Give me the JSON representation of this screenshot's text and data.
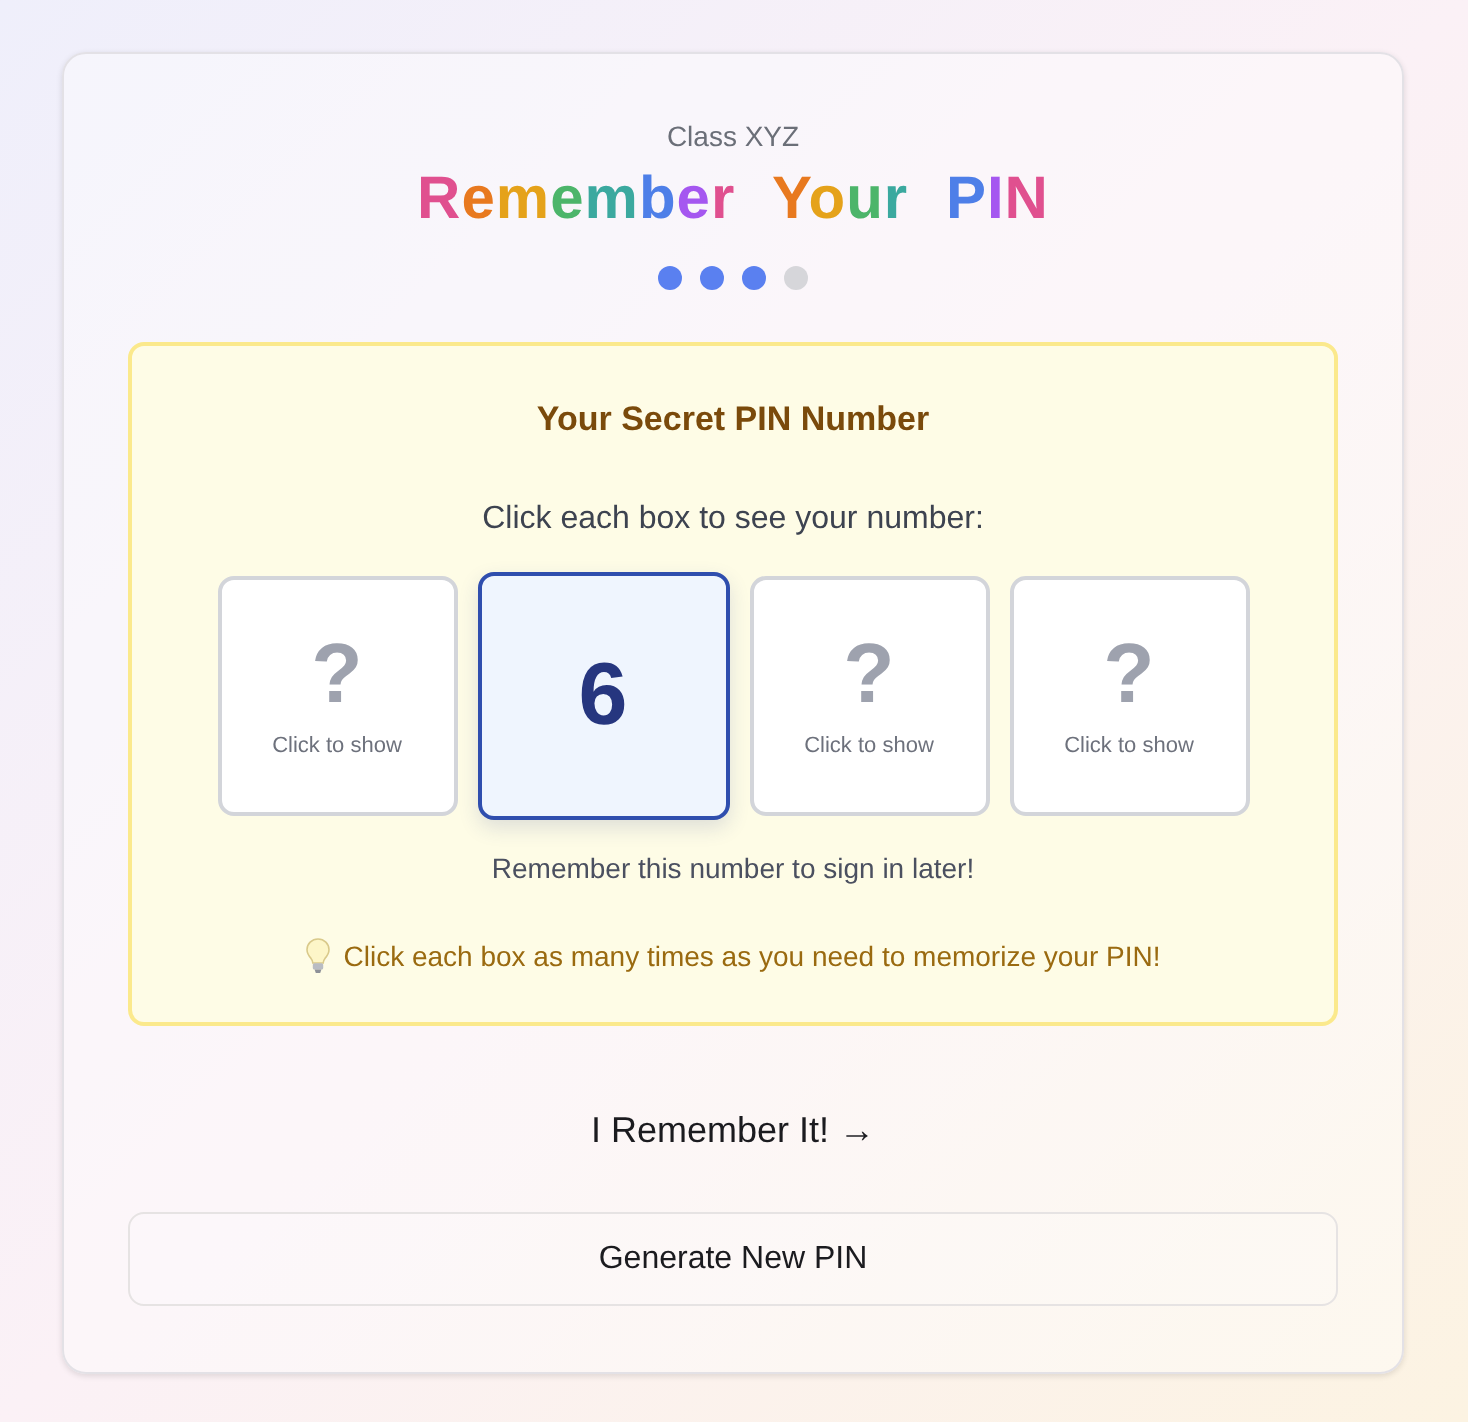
{
  "header": {
    "subtitle": "Class XYZ",
    "title": "Remember Your PIN"
  },
  "progress_steps": [
    {
      "completed": true
    },
    {
      "completed": true
    },
    {
      "completed": true
    },
    {
      "completed": false
    }
  ],
  "pin_panel": {
    "heading": "Your Secret PIN Number",
    "instruction": "Click each box to see your number:",
    "digits": [
      {
        "revealed": false,
        "symbol": "?",
        "caption": "Click to show"
      },
      {
        "revealed": true,
        "symbol": "6"
      },
      {
        "revealed": false,
        "symbol": "?",
        "caption": "Click to show"
      },
      {
        "revealed": false,
        "symbol": "?",
        "caption": "Click to show"
      }
    ],
    "reminder": "Remember this number to sign in later!",
    "tip": "Click each box as many times as you need to memorize your PIN!"
  },
  "actions": {
    "confirm": "I Remember It! →",
    "regenerate": "Generate New PIN"
  }
}
